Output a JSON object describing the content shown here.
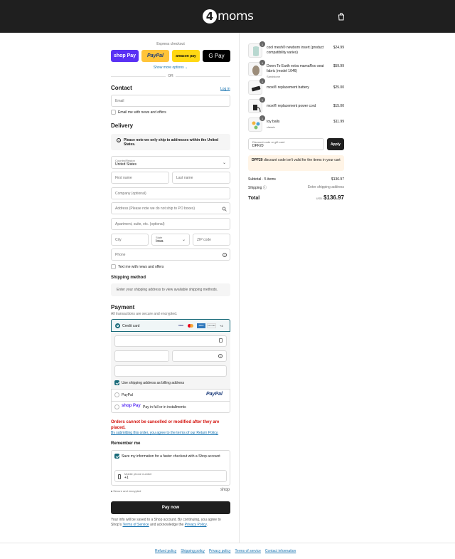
{
  "header": {
    "brand_badge": "4",
    "brand_text": "moms"
  },
  "express": {
    "label": "Express checkout",
    "shop_pay": "shop Pay",
    "paypal": "PayPal",
    "amazon": "amazon pay",
    "gpay": "G Pay",
    "show_more": "Show more options ⌄",
    "or": "OR"
  },
  "contact": {
    "title": "Contact",
    "login": "Log in",
    "email_placeholder": "Email",
    "news_label": "Email me with news and offers"
  },
  "delivery": {
    "title": "Delivery",
    "notice": "Please note we only ship to addresses within the United States.",
    "country_label": "Country/Region",
    "country_value": "United States",
    "first_name": "First name",
    "last_name": "Last name",
    "company": "Company (optional)",
    "address": "Address (Please note we do not ship to PO boxes)",
    "apartment": "Apartment, suite, etc. (optional)",
    "city": "City",
    "state_label": "State",
    "state_value": "Iowa",
    "zip": "ZIP code",
    "phone": "Phone",
    "text_label": "Text me with news and offers"
  },
  "shipping_method": {
    "title": "Shipping method",
    "note": "Enter your shipping address to view available shipping methods."
  },
  "payment": {
    "title": "Payment",
    "subtitle": "All transactions are secure and encrypted.",
    "credit_card": "Credit card",
    "card_brands": [
      "VISA",
      "MC",
      "AMEX",
      "DISCOVER",
      "+4"
    ],
    "billing_label": "Use shipping address as billing address",
    "paypal": "PayPal",
    "paypal_logo": "PayPal",
    "shoppay_logo": "shop Pay",
    "shoppay_text": "Pay in full or in installments"
  },
  "warning": {
    "text": "Orders cannot be cancelled or modified after they are placed.",
    "terms": "By submitting this order, you agree to the terms of our Return Policy."
  },
  "remember": {
    "title": "Remember me",
    "save_label": "Save my information for a faster checkout with a Shop account",
    "mobile_label": "Mobile phone number",
    "mobile_value": "+1",
    "secure": "Secure and encrypted",
    "shop": "shop"
  },
  "pay_now": "Pay now",
  "legal": {
    "line1": "Your info will be saved to a Shop account. By continuing, you agree to Shop's",
    "terms": "Terms of Service",
    "mid": "and acknowledge the",
    "privacy": "Privacy Policy",
    "end": "."
  },
  "cart": {
    "items": [
      {
        "qty": "1",
        "name": "cool mesh® newborn insert (product compatibility varies)",
        "variant": "",
        "price": "$24.99"
      },
      {
        "qty": "1",
        "name": "Down To Earth extra mamaRoo seat fabric (model 1046)",
        "variant": "Sandstone",
        "price": "$59.99"
      },
      {
        "qty": "1",
        "name": "moxi® replacement battery",
        "variant": "",
        "price": "$25.00"
      },
      {
        "qty": "1",
        "name": "moxi® replacement power cord",
        "variant": "",
        "price": "$15.00"
      },
      {
        "qty": "1",
        "name": "toy balls",
        "variant": "classic",
        "price": "$11.99"
      }
    ],
    "discount_label": "Discount code or gift card",
    "discount_value": "DPF20",
    "apply": "Apply",
    "discount_warning_code": "DPF20",
    "discount_warning_text": "discount code isn't valid for the items in your cart",
    "subtotal_label": "Subtotal · 5 items",
    "subtotal_value": "$136.97",
    "shipping_label": "Shipping ⓘ",
    "shipping_value": "Enter shipping address",
    "total_label": "Total",
    "total_currency": "USD",
    "total_value": "$136.97"
  },
  "footer": [
    "Refund policy",
    "Shipping policy",
    "Privacy policy",
    "Terms of service",
    "Contact information"
  ]
}
